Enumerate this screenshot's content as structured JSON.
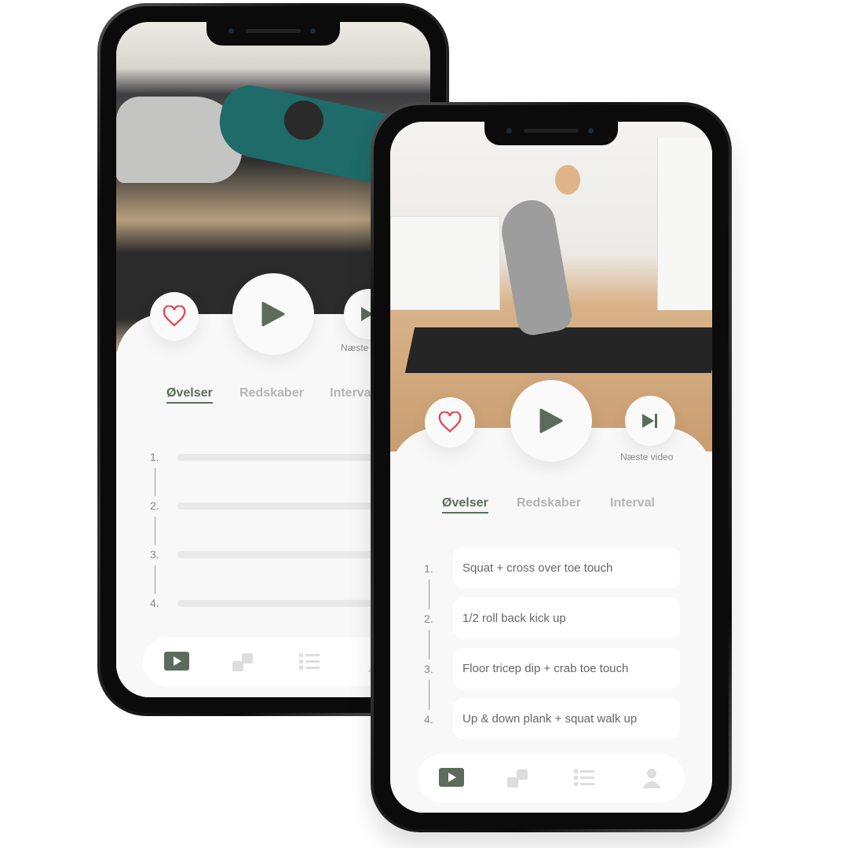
{
  "colors": {
    "accent": "#5d6b5c",
    "heart": "#e8434f",
    "inactive": "#b5b5b5"
  },
  "controls": {
    "favorite_icon": "heart-icon",
    "play_icon": "play-icon",
    "next_icon": "skip-next-icon",
    "next_label": "Næste video"
  },
  "tabs": [
    {
      "label": "Øvelser",
      "active": true
    },
    {
      "label": "Redskaber"
    },
    {
      "label": "Interval"
    }
  ],
  "exercises": [
    {
      "number": "1.",
      "name": "Squat + cross over toe touch"
    },
    {
      "number": "2.",
      "name": "1/2 roll back kick up"
    },
    {
      "number": "3.",
      "name": "Floor tricep dip + crab toe touch"
    },
    {
      "number": "4.",
      "name": "Up & down plank  + squat walk up"
    }
  ],
  "bottom_nav": [
    {
      "icon": "video-play-icon",
      "active": true
    },
    {
      "icon": "programs-icon"
    },
    {
      "icon": "list-icon"
    },
    {
      "icon": "profile-icon"
    }
  ]
}
